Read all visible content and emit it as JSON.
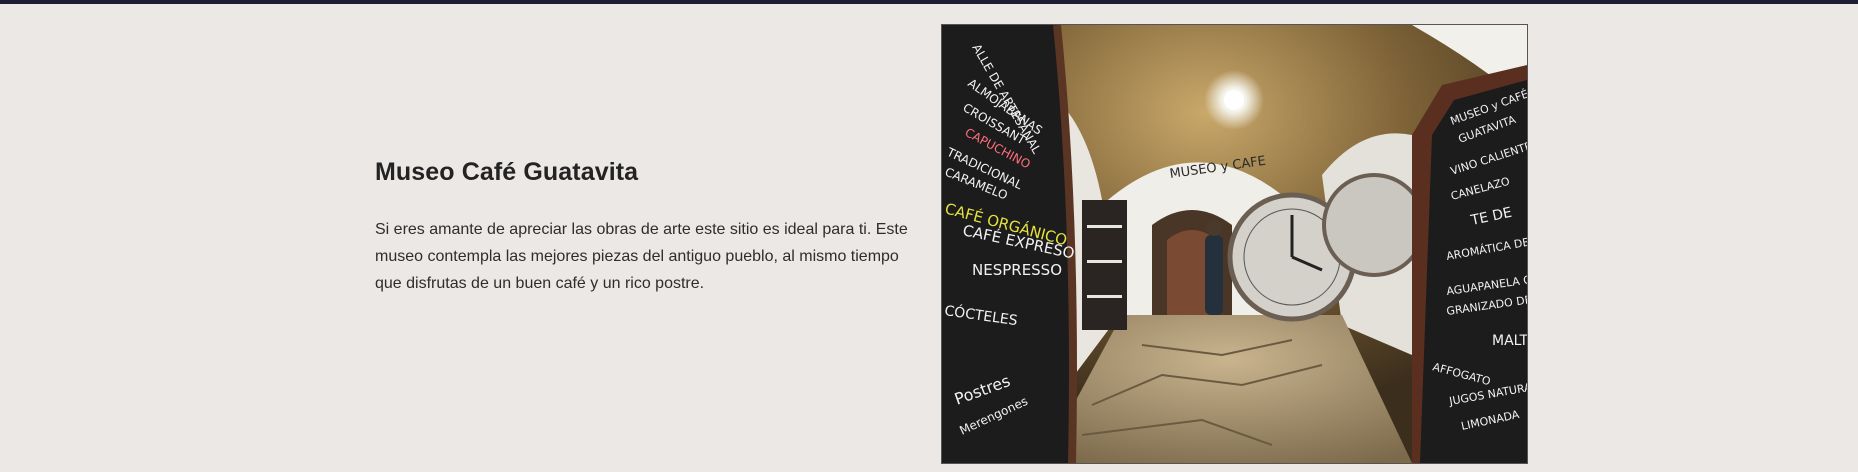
{
  "section": {
    "title": "Museo Café Guatavita",
    "description": "Si eres amante de apreciar las obras de arte este sitio es ideal para ti. Este museo contempla las mejores piezas del antiguo pueblo, al mismo tiempo que disfrutas de un buen café y un rico postre."
  },
  "photo": {
    "arch_sign": "MUSEO y CAFE",
    "left_board": [
      "ALLE DE ARTESANAL",
      "ALMOJÁBANAS",
      "CROISSANT",
      "CAPUCHINO",
      "TRADICIONAL",
      "CARAMELO",
      "CAFÉ ORGÁNICO",
      "CAFÉ EXPRESO",
      "NESPRESSO",
      "CÓCTELES",
      "Postres",
      "Merengones"
    ],
    "right_board": [
      "MUSEO y CAFÉ",
      "GUATAVITA",
      "VINO CALIENTE",
      "CANELAZO",
      "TE DE",
      "AROMÁTICA DE",
      "AGUAPANELA CON",
      "GRANIZADO DE CAFÉ",
      "MALTE",
      "AFFOGATO",
      "JUGOS NATURALES",
      "LIMONADA"
    ]
  },
  "colors": {
    "top_border": "#1e1d33",
    "background": "#ece8e5"
  }
}
